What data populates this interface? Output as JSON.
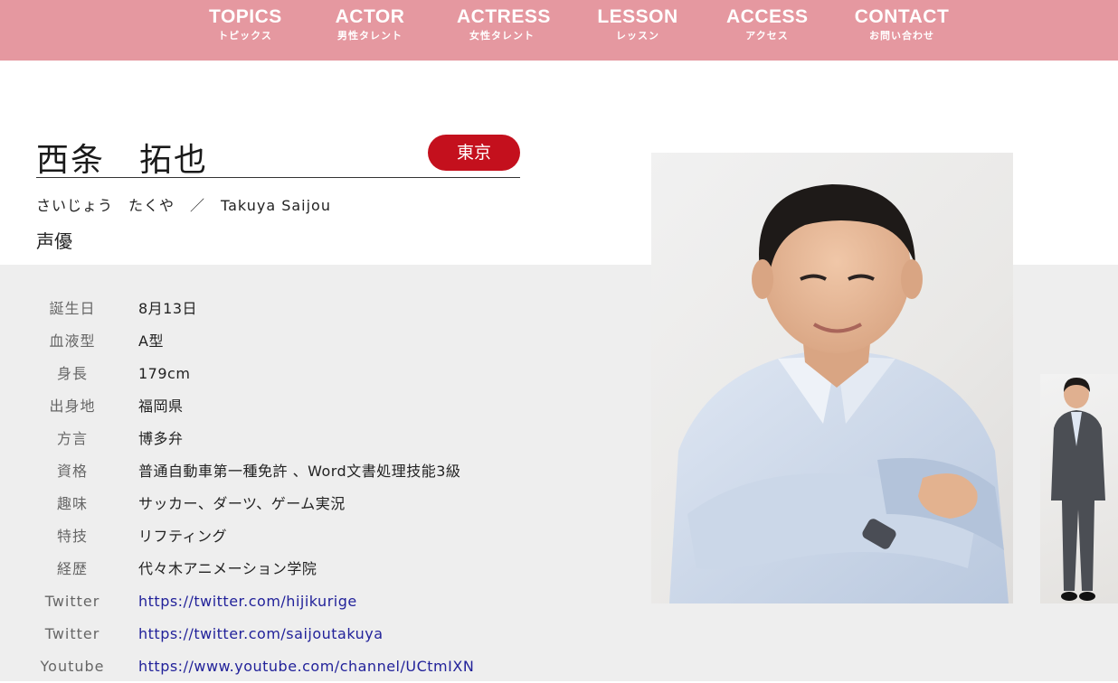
{
  "nav": [
    {
      "en": "TOPICS",
      "jp": "トピックス"
    },
    {
      "en": "ACTOR",
      "jp": "男性タレント"
    },
    {
      "en": "ACTRESS",
      "jp": "女性タレント"
    },
    {
      "en": "LESSON",
      "jp": "レッスン"
    },
    {
      "en": "ACCESS",
      "jp": "アクセス"
    },
    {
      "en": "CONTACT",
      "jp": "お問い合わせ"
    }
  ],
  "talent": {
    "name": "西条　拓也",
    "region": "東京",
    "kana": "さいじょう　たくや　／　Takuya Saijou",
    "occupation": "声優"
  },
  "profile": [
    {
      "label": "誕生日",
      "value": "8月13日"
    },
    {
      "label": "血液型",
      "value": "A型"
    },
    {
      "label": "身長",
      "value": "179cm"
    },
    {
      "label": "出身地",
      "value": "福岡県"
    },
    {
      "label": "方言",
      "value": "博多弁"
    },
    {
      "label": "資格",
      "value": "普通自動車第一種免許 、Word文書処理技能3級"
    },
    {
      "label": "趣味",
      "value": "サッカー、ダーツ、ゲーム実況"
    },
    {
      "label": "特技",
      "value": "リフティング"
    },
    {
      "label": "経歴",
      "value": "代々木アニメーション学院"
    },
    {
      "label": "Twitter",
      "value": "https://twitter.com/hijikurige"
    },
    {
      "label": "Twitter",
      "value": "https://twitter.com/saijoutakuya"
    },
    {
      "label": "Youtube",
      "value": "https://www.youtube.com/channel/UCtmIXN"
    }
  ],
  "colors": {
    "nav_bg": "#e598a0",
    "badge": "#c4101d",
    "link": "#22229a",
    "band": "#eeeeee"
  }
}
